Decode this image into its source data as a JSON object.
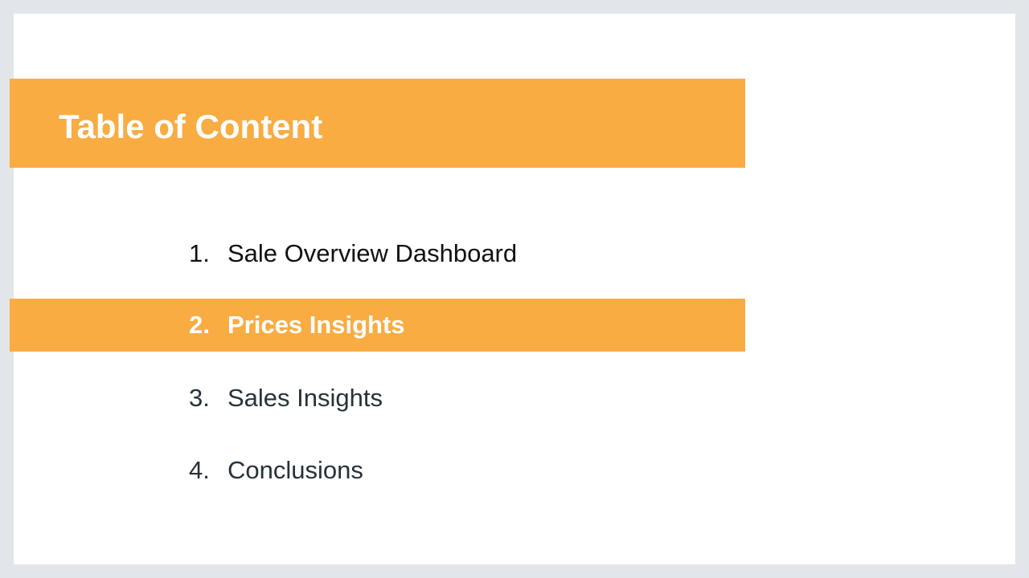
{
  "slide": {
    "title": "Table of Content",
    "items": [
      {
        "number": "1.",
        "label": "Sale Overview Dashboard"
      },
      {
        "number": "2.",
        "label": "Prices Insights"
      },
      {
        "number": "3.",
        "label": "Sales Insights"
      },
      {
        "number": "4.",
        "label": "Conclusions"
      }
    ]
  },
  "colors": {
    "accent": "#f9ac42",
    "background": "#e2e6ea",
    "slide": "#ffffff",
    "text_dark": "#111111",
    "text_slate": "#263238",
    "text_on_accent": "#ffffff"
  }
}
